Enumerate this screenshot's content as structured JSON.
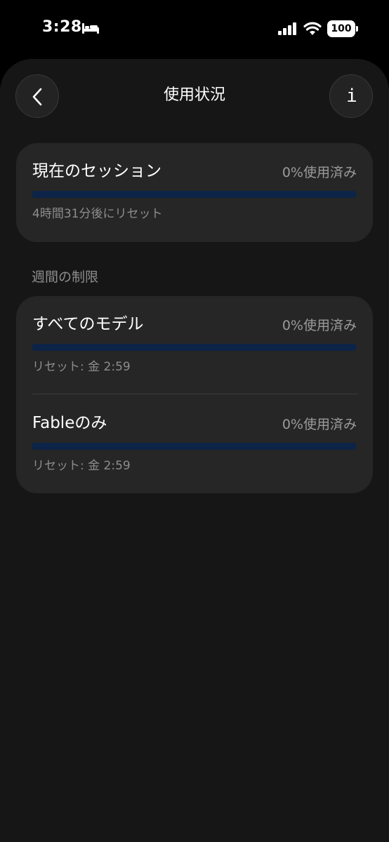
{
  "status_bar": {
    "time": "3:28",
    "battery": "100",
    "icons": [
      "sleep-focus-icon",
      "cellular-signal-icon",
      "wifi-icon",
      "battery-icon"
    ]
  },
  "header": {
    "title": "使用状況",
    "back_icon": "chevron-left-icon",
    "info_label": "i"
  },
  "current_session": {
    "name": "現在のセッション",
    "percent_text": "0%使用済み",
    "used_fraction": 0,
    "reset_text": "4時間31分後にリセット"
  },
  "weekly": {
    "heading": "週間の制限",
    "items": [
      {
        "name": "すべてのモデル",
        "percent_text": "0%使用済み",
        "used_fraction": 0,
        "reset_text": "リセット: 金 2:59"
      },
      {
        "name": "Fableのみ",
        "percent_text": "0%使用済み",
        "used_fraction": 0,
        "reset_text": "リセット: 金 2:59"
      }
    ]
  },
  "colors": {
    "background": "#161616",
    "card": "#262626",
    "track": "#0c2447",
    "fill": "#4a8ff0",
    "secondary_text": "#8d8d8d"
  }
}
